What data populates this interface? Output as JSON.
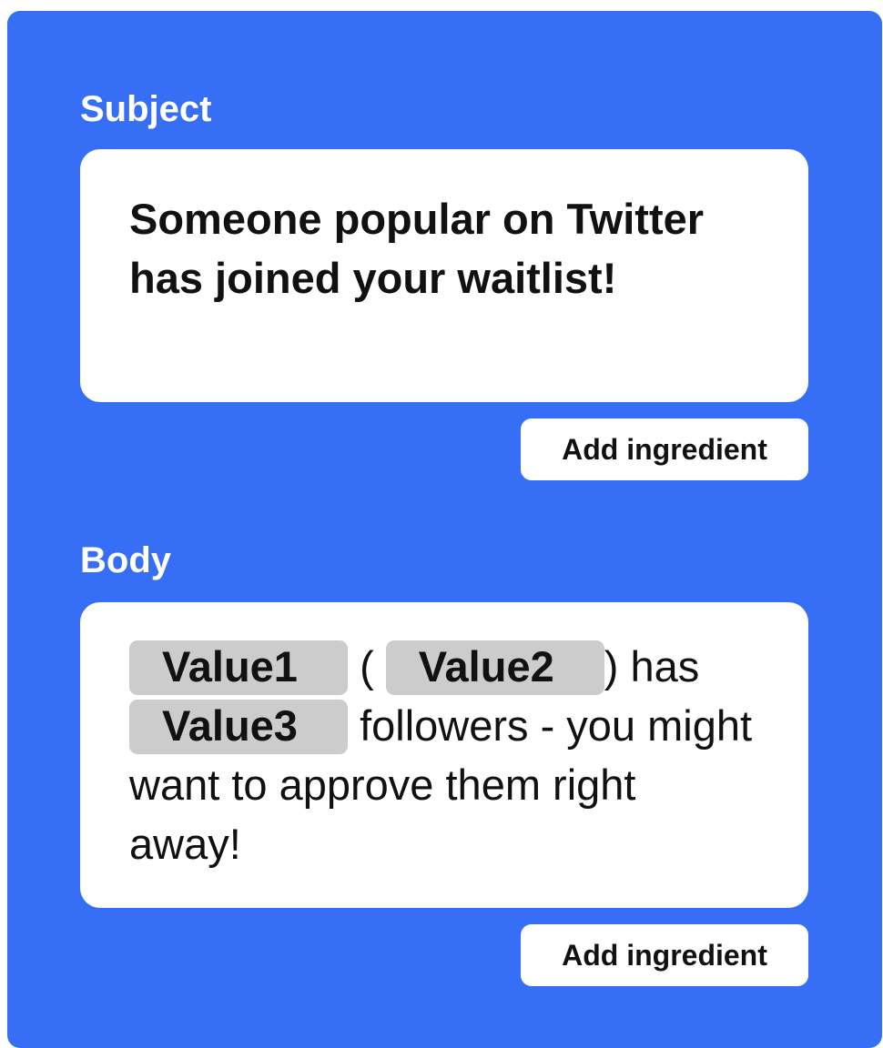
{
  "subject": {
    "label": "Subject",
    "text": "Someone popular on Twitter has joined your waitlist!",
    "add_button": "Add ingredient"
  },
  "body": {
    "label": "Body",
    "value1": "Value1",
    "open_paren": "(",
    "value2": "Value2",
    "close_has": ") has",
    "value3": "Value3",
    "text_after": "followers - you might want to approve them right away!",
    "add_button": "Add ingredient"
  },
  "colors": {
    "panel": "#366ff6",
    "field": "#ffffff",
    "ingredient_pill": "#cccccc"
  }
}
